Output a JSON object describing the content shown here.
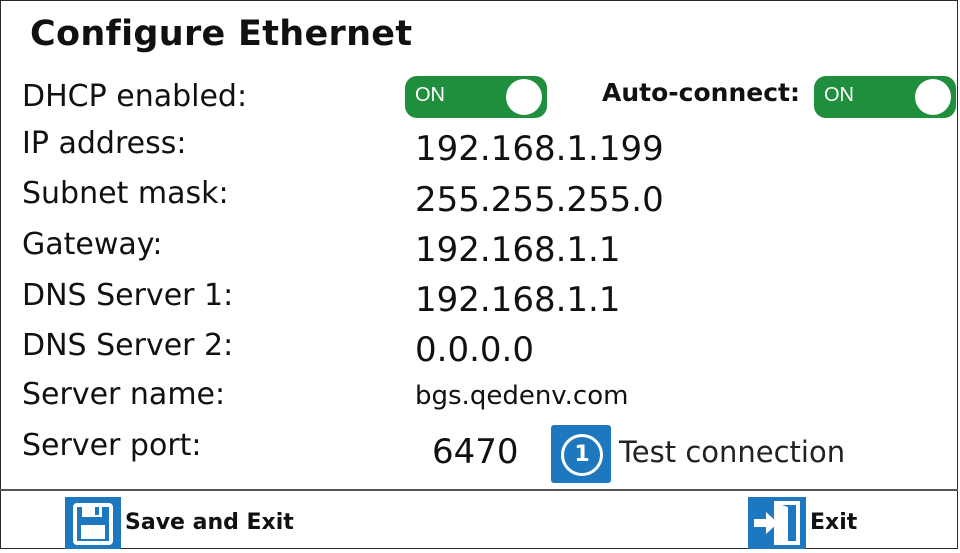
{
  "title": "Configure Ethernet",
  "dhcp": {
    "label": "DHCP enabled:",
    "toggle": "ON"
  },
  "auto_connect": {
    "label": "Auto-connect:",
    "toggle": "ON"
  },
  "fields": {
    "ip": {
      "label": "IP address:",
      "value": "192.168.1.199"
    },
    "subnet": {
      "label": "Subnet mask:",
      "value": "255.255.255.0"
    },
    "gateway": {
      "label": "Gateway:",
      "value": "192.168.1.1"
    },
    "dns1": {
      "label": "DNS Server 1:",
      "value": "192.168.1.1"
    },
    "dns2": {
      "label": "DNS Server 2:",
      "value": "0.0.0.0"
    },
    "server_name": {
      "label": "Server name:",
      "value": "bgs.qedenv.com"
    },
    "server_port": {
      "label": "Server port:",
      "value": "6470"
    }
  },
  "test_connection": {
    "icon_number": "1",
    "label": "Test connection",
    "icon": "info-number-icon"
  },
  "footer": {
    "save_label": "Save and Exit",
    "save_icon": "floppy-disk-icon",
    "exit_label": "Exit",
    "exit_icon": "door-exit-icon"
  },
  "colors": {
    "toggle_on": "#1f8f3e",
    "accent": "#1d78c0"
  }
}
